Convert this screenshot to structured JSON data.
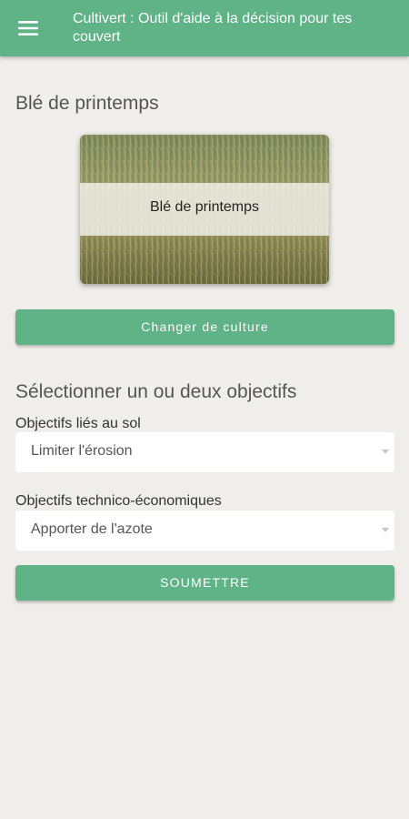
{
  "header": {
    "title": "Cultivert : Outil d'aide à la décision pour tes couvert"
  },
  "crop": {
    "heading": "Blé de printemps",
    "card_label": "Blé de printemps",
    "change_button": "Changer de culture"
  },
  "objectives": {
    "heading": "Sélectionner un ou deux objectifs",
    "soil": {
      "label": "Objectifs liés au sol",
      "value": "Limiter l'érosion"
    },
    "technico": {
      "label": "Objectifs technico-économiques",
      "value": "Apporter de l'azote"
    },
    "submit_button": "SOUMETTRE"
  },
  "colors": {
    "primary": "#5fb386",
    "background": "#f0eeea"
  },
  "icons": {
    "menu": "hamburger-menu-icon",
    "dropdown": "caret-down-icon"
  }
}
